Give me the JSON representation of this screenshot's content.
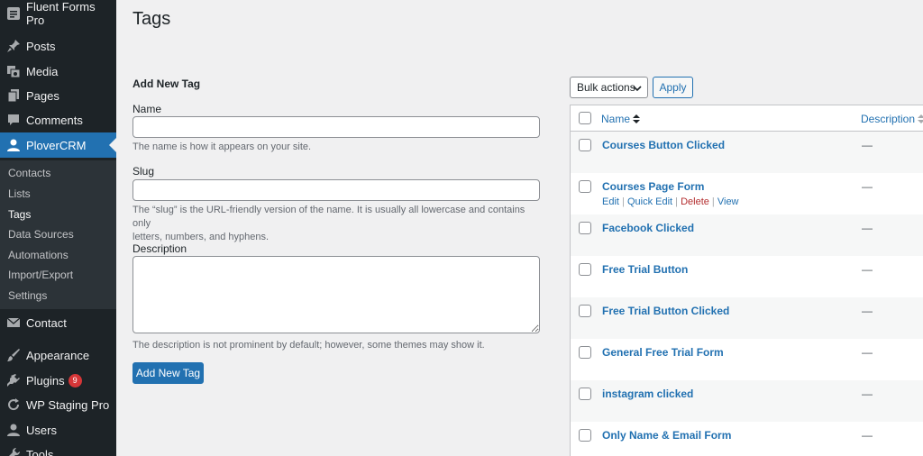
{
  "sidebar": {
    "items": [
      {
        "label": "Fluent Forms Pro",
        "icon": "forms-icon"
      },
      {
        "label": "Posts",
        "icon": "pin-icon"
      },
      {
        "label": "Media",
        "icon": "media-icon"
      },
      {
        "label": "Pages",
        "icon": "pages-icon"
      },
      {
        "label": "Comments",
        "icon": "comment-icon"
      },
      {
        "label": "PloverCRM",
        "icon": "user-icon"
      },
      {
        "label": "Contact",
        "icon": "mail-icon"
      },
      {
        "label": "Appearance",
        "icon": "brush-icon"
      },
      {
        "label": "Plugins",
        "icon": "plugin-icon",
        "badge": "9"
      },
      {
        "label": "WP Staging Pro",
        "icon": "refresh-icon"
      },
      {
        "label": "Users",
        "icon": "users-icon"
      },
      {
        "label": "Tools",
        "icon": "wrench-icon"
      }
    ],
    "submenu": [
      "Contacts",
      "Lists",
      "Tags",
      "Data Sources",
      "Automations",
      "Import/Export",
      "Settings"
    ],
    "active_color": "#2271b1"
  },
  "page": {
    "title": "Tags"
  },
  "form": {
    "title": "Add New Tag",
    "name_label": "Name",
    "name_help": "The name is how it appears on your site.",
    "slug_label": "Slug",
    "slug_help_1": "The “slug” is the URL-friendly version of the name. It is usually all lowercase and contains only",
    "slug_help_2": "letters, numbers, and hyphens.",
    "description_label": "Description",
    "description_help": "The description is not prominent by default; however, some themes may show it.",
    "submit_label": "Add New Tag"
  },
  "bulk": {
    "select_value": "Bulk actions",
    "apply_label": "Apply"
  },
  "table": {
    "col_name": "Name",
    "col_description": "Description",
    "rows": [
      {
        "name": "Courses Button Clicked",
        "description": "—"
      },
      {
        "name": "Courses Page Form",
        "description": "—",
        "actions": {
          "edit": "Edit",
          "quick_edit": "Quick Edit",
          "delete": "Delete",
          "view": "View"
        }
      },
      {
        "name": "Facebook Clicked",
        "description": "—"
      },
      {
        "name": "Free Trial Button",
        "description": "—"
      },
      {
        "name": "Free Trial Button Clicked",
        "description": "—"
      },
      {
        "name": "General Free Trial Form",
        "description": "—"
      },
      {
        "name": "instagram clicked",
        "description": "—"
      },
      {
        "name": "Only Name & Email Form",
        "description": "—"
      }
    ]
  }
}
